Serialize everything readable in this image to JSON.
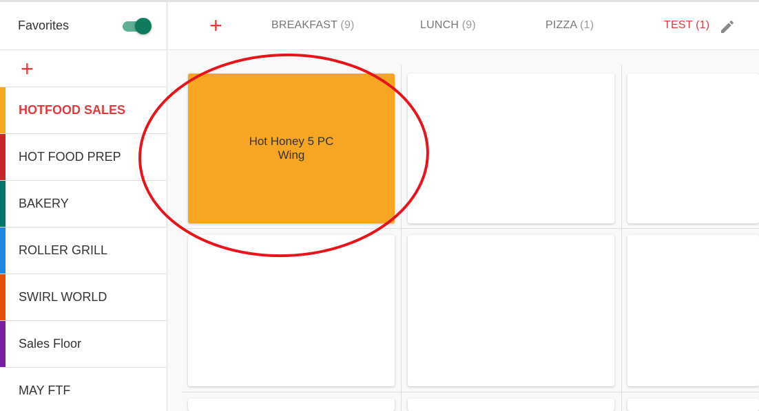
{
  "sidebar": {
    "favorites_label": "Favorites",
    "favorites_on": true,
    "add_symbol": "+",
    "categories": [
      {
        "label": "HOTFOOD SALES",
        "color": "#f6a623",
        "active": true
      },
      {
        "label": "HOT FOOD PREP",
        "color": "#c62828",
        "active": false
      },
      {
        "label": "BAKERY",
        "color": "#00796b",
        "active": false
      },
      {
        "label": "ROLLER GRILL",
        "color": "#1e88e5",
        "active": false
      },
      {
        "label": "SWIRL WORLD",
        "color": "#e65100",
        "active": false
      },
      {
        "label": "Sales Floor",
        "color": "#7b1fa2",
        "active": false
      },
      {
        "label": "MAY FTF",
        "color": "#ffffff",
        "active": false
      }
    ]
  },
  "tabs": {
    "add_symbol": "+",
    "items": [
      {
        "label": "BREAKFAST",
        "count": "(9)"
      },
      {
        "label": "LUNCH",
        "count": "(9)"
      },
      {
        "label": "PIZZA",
        "count": "(1)"
      },
      {
        "label": "TEST",
        "count": "(1)",
        "active": true
      }
    ]
  },
  "grid": {
    "items": [
      {
        "line1": "Hot Honey 5 PC",
        "line2": "Wing",
        "color": "#f6a623"
      }
    ]
  },
  "colors": {
    "accent_red": "#e03a3a",
    "toggle_green": "#0f7a5d",
    "item_orange": "#f6a623"
  }
}
